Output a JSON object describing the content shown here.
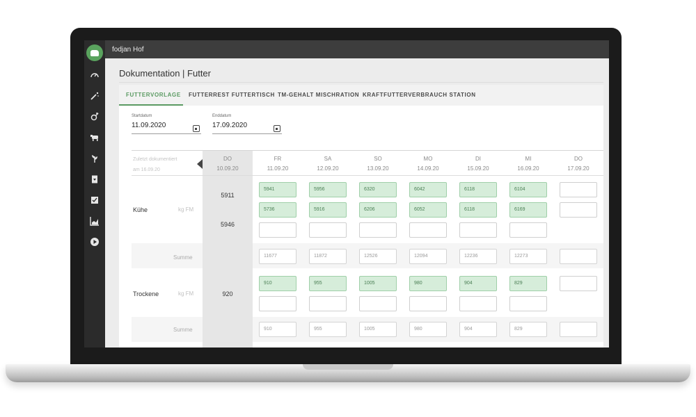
{
  "app": {
    "title": "fodjan Hof"
  },
  "page": {
    "title": "Dokumentation | Futter"
  },
  "sidebar": {
    "icons": [
      "gauge-icon",
      "magic-wand-icon",
      "gender-icon",
      "cow-icon",
      "plant-icon",
      "document-download-icon",
      "checklist-icon",
      "bar-chart-icon",
      "play-icon"
    ]
  },
  "tabs": [
    {
      "label": "FUTTERVORLAGE",
      "active": true
    },
    {
      "label": "FUTTERREST FUTTERTISCH",
      "active": false
    },
    {
      "label": "TM-GEHALT MISCHRATION",
      "active": false
    },
    {
      "label": "KRAFTFUTTERVERBRAUCH STATION",
      "active": false
    }
  ],
  "dates": {
    "start": {
      "label": "Startdatum",
      "value": "11.09.2020"
    },
    "end": {
      "label": "Enddatum",
      "value": "17.09.2020"
    }
  },
  "table": {
    "hint_line1": "Zuletzt dokumentiert",
    "hint_line2": "am 16.09.20",
    "columns": [
      {
        "day": "DO",
        "date": "10.09.20"
      },
      {
        "day": "FR",
        "date": "11.09.20"
      },
      {
        "day": "SA",
        "date": "12.09.20"
      },
      {
        "day": "SO",
        "date": "13.09.20"
      },
      {
        "day": "MO",
        "date": "14.09.20"
      },
      {
        "day": "DI",
        "date": "15.09.20"
      },
      {
        "day": "MI",
        "date": "16.09.20"
      },
      {
        "day": "DO",
        "date": "17.09.20"
      }
    ],
    "groups": [
      {
        "label": "Kühe",
        "unit": "kg FM",
        "last_values": [
          "5911",
          "5946"
        ],
        "row1": [
          "5941",
          "5956",
          "6320",
          "6042",
          "6118",
          "6104",
          ""
        ],
        "row2": [
          "5736",
          "5916",
          "6206",
          "6052",
          "6118",
          "6169",
          ""
        ],
        "row3": [
          "",
          "",
          "",
          "",
          "",
          ""
        ],
        "sum_label": "Summe",
        "sums": [
          "11677",
          "11872",
          "12526",
          "12094",
          "12236",
          "12273",
          ""
        ]
      },
      {
        "label": "Trockene",
        "unit": "kg FM",
        "last_values": [
          "920"
        ],
        "row1": [
          "910",
          "955",
          "1005",
          "980",
          "904",
          "829",
          ""
        ],
        "row2": [
          "",
          "",
          "",
          "",
          "",
          ""
        ],
        "sum_label": "Summe",
        "sums": [
          "910",
          "955",
          "1005",
          "980",
          "904",
          "829",
          ""
        ]
      }
    ]
  },
  "colors": {
    "accent_green": "#5a9a62",
    "cell_green": "#d6edda",
    "sidebar": "#2b2b2b",
    "topbar": "#3d3d3d"
  }
}
